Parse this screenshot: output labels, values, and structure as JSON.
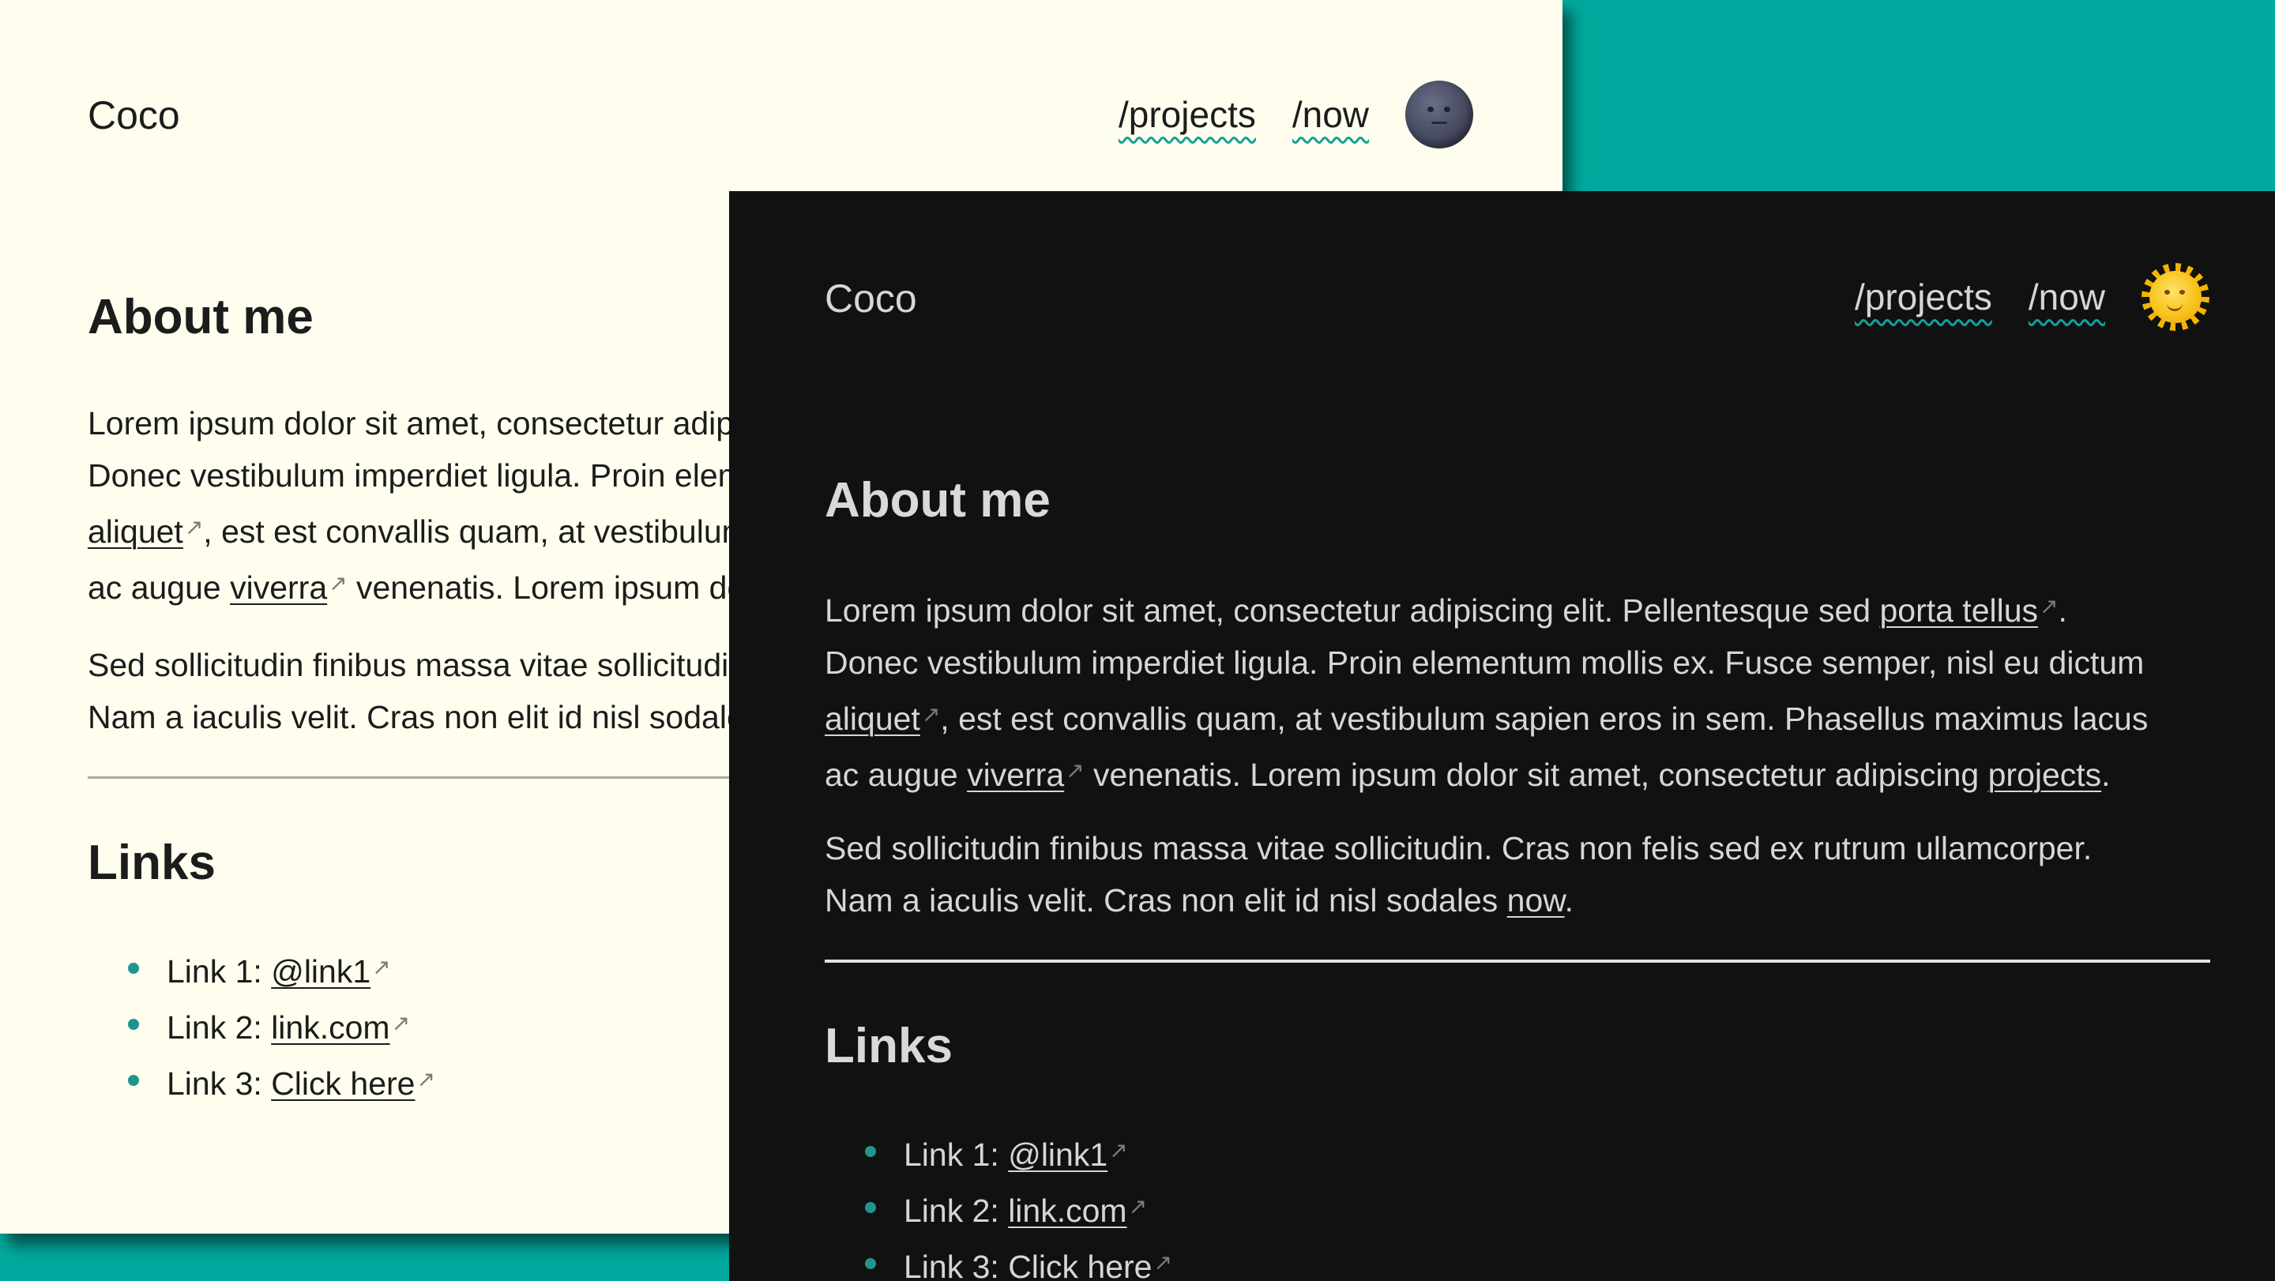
{
  "site": {
    "name": "Coco",
    "nav": [
      "/projects",
      "/now"
    ],
    "accent_color": "#12a198",
    "background_color": "#00a99d"
  },
  "light_theme": {
    "toggle_icon": "moon-icon",
    "background": "#fefdee"
  },
  "dark_theme": {
    "toggle_icon": "sun-icon",
    "background": "#111111"
  },
  "about": {
    "heading": "About me",
    "p1": {
      "line1_text": "Lorem ipsum dolor sit amet, consectetur adipiscing elit. Pellentesque sed ",
      "line1_link": "porta tellus",
      "line1_end": ".",
      "line2_text": "Donec vestibulum imperdiet ligula. Proin elementum mollis ex. Fusce semper, nisl eu dictum",
      "line3_link": "aliquet",
      "line3_text": ", est est convallis quam, at vestibulum sapien eros in sem. Phasellus maximus lacus",
      "line4_text_a": "ac augue ",
      "line4_link_a": "viverra",
      "line4_text_b": " venenatis. Lorem ipsum dolor sit amet, consectetur adipiscing ",
      "line4_link_b": "projects",
      "line4_end": "."
    },
    "p2": {
      "line1_text": "Sed sollicitudin finibus massa vitae sollicitudin. Cras non felis sed ex rutrum ullamcorper.",
      "line2_text": "Nam a iaculis velit. Cras non elit id nisl sodales ",
      "line2_link": "now",
      "line2_end": "."
    }
  },
  "links": {
    "heading": "Links",
    "items": [
      {
        "prefix": "Link 1: ",
        "label": "@link1"
      },
      {
        "prefix": "Link 2: ",
        "label": "link.com"
      },
      {
        "prefix": "Link 3: ",
        "label": "Click here"
      }
    ],
    "external_arrow": "↗"
  }
}
